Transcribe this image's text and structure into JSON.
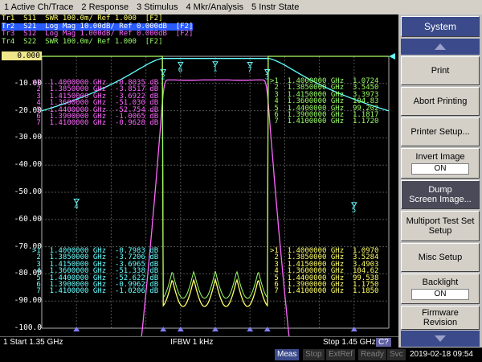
{
  "menu": [
    "1 Active Ch/Trace",
    "2 Response",
    "3 Stimulus",
    "4 Mkr/Analysis",
    "5 Instr State"
  ],
  "traces": [
    {
      "label": "Tr1",
      "text": "Tr1  S11  SWR 100.0m/ Ref 1.000  [F2]",
      "color": "#ffff66",
      "active": false
    },
    {
      "label": "Tr2",
      "text": "Tr2  S21  Log Mag 10.00dB/ Ref 0.000dB  [F2]",
      "color": "#66ffff",
      "active": true
    },
    {
      "label": "Tr3",
      "text": "Tr3  S12  Log Mag 1.000dB/ Ref 0.000dB  [F2]",
      "color": "#ff66ff",
      "active": false
    },
    {
      "label": "Tr4",
      "text": "Tr4  S22  SWR 100.0m/ Ref 1.000  [F2]",
      "color": "#99ff66",
      "active": false
    }
  ],
  "y_axis": {
    "labels": [
      "0.000",
      "-10.00",
      "-20.00",
      "-30.00",
      "-40.00",
      "-50.00",
      "-60.00",
      "-70.00",
      "-80.00",
      "-90.00",
      "-100.0"
    ],
    "ref_index": 0
  },
  "marker_tables": {
    "top_left": {
      "color": "#ff66ff",
      "rows": [
        ">1  1.4000000 GHz  -0.8035 dB",
        " 2  1.3850000 GHz  -3.8517 dB",
        " 3  1.4150000 GHz  -3.6922 dB",
        " 4  1.3600000 GHz  -51.030 dB",
        " 5  1.4400000 GHz  -52.754 dB",
        " 6  1.3900000 GHz  -1.0065 dB",
        " 7  1.4100000 GHz  -0.9628 dB"
      ]
    },
    "top_right": {
      "color": "#99ff66",
      "rows": [
        ">1  1.4000000 GHz  1.0724",
        " 2  1.3850000 GHz  3.5450",
        " 3  1.4150000 GHz  3.3973",
        " 4  1.3600000 GHz  104.83",
        " 5  1.4400000 GHz  99.202",
        " 6  1.3900000 GHz  1.1817",
        " 7  1.4100000 GHz  1.1720"
      ]
    },
    "bottom_left": {
      "color": "#66ffff",
      "rows": [
        ">1  1.4000000 GHz  -0.7983 dB",
        " 2  1.3850000 GHz  -3.7206 dB",
        " 3  1.4150000 GHz  -3.6965 dB",
        " 4  1.3600000 GHz  -51.338 dB",
        " 5  1.4400000 GHz  -52.622 dB",
        " 6  1.3900000 GHz  -0.9962 dB",
        " 7  1.4100000 GHz  -1.0206 dB"
      ]
    },
    "bottom_right": {
      "color": "#ffff66",
      "rows": [
        ">1  1.4000000 GHz  1.0970",
        " 2  1.3850000 GHz  3.5284",
        " 3  1.4150000 GHz  3.4903",
        " 4  1.3600000 GHz  104.62",
        " 5  1.4400000 GHz  99.538",
        " 6  1.3900000 GHz  1.1750",
        " 7  1.4100000 GHz  1.1850"
      ]
    }
  },
  "status": {
    "start": "1  Start 1.35 GHz",
    "ifbw": "IFBW 1 kHz",
    "stop": "Stop 1.45 GHz",
    "channel": "C?"
  },
  "bottom": {
    "meas": "Meas",
    "stop": "Stop",
    "ext_ref": "ExtRef",
    "ready": "Ready",
    "svc": "Svc",
    "datetime": "2019-02-18 09:54"
  },
  "softkeys": {
    "title": "System",
    "print": "Print",
    "abort_printing": "Abort Printing",
    "printer_setup": "Printer Setup...",
    "invert_image": "Invert Image",
    "invert_image_value": "ON",
    "dump_screen_1": "Dump",
    "dump_screen_2": "Screen Image...",
    "multiport_1": "Multiport Test Set",
    "multiport_2": "Setup",
    "misc_setup": "Misc Setup",
    "backlight": "Backlight",
    "backlight_value": "ON",
    "firmware_1": "Firmware",
    "firmware_2": "Revision"
  },
  "chart_data": {
    "type": "line",
    "x_unit": "GHz",
    "xlim": [
      1.35,
      1.45
    ],
    "ylim_s21": [
      -100,
      0
    ],
    "series": [
      {
        "name": "S11",
        "color": "#ffff66",
        "x": [
          1.4,
          1.385,
          1.415,
          1.36,
          1.44,
          1.39,
          1.41
        ],
        "y": [
          1.097,
          3.5284,
          3.4903,
          104.62,
          99.538,
          1.175,
          1.185
        ]
      },
      {
        "name": "S21",
        "color": "#66ffff",
        "x": [
          1.4,
          1.385,
          1.415,
          1.36,
          1.44,
          1.39,
          1.41
        ],
        "y": [
          -0.7983,
          -3.7206,
          -3.6965,
          -51.338,
          -52.622,
          -0.9962,
          -1.0206
        ]
      },
      {
        "name": "S12",
        "color": "#ff66ff",
        "x": [
          1.4,
          1.385,
          1.415,
          1.36,
          1.44,
          1.39,
          1.41
        ],
        "y": [
          -0.8035,
          -3.8517,
          -3.6922,
          -51.03,
          -52.754,
          -1.0065,
          -0.9628
        ]
      },
      {
        "name": "S22",
        "color": "#99ff66",
        "x": [
          1.4,
          1.385,
          1.415,
          1.36,
          1.44,
          1.39,
          1.41
        ],
        "y": [
          1.0724,
          3.545,
          3.3973,
          104.83,
          99.202,
          1.1817,
          1.172
        ]
      }
    ]
  }
}
